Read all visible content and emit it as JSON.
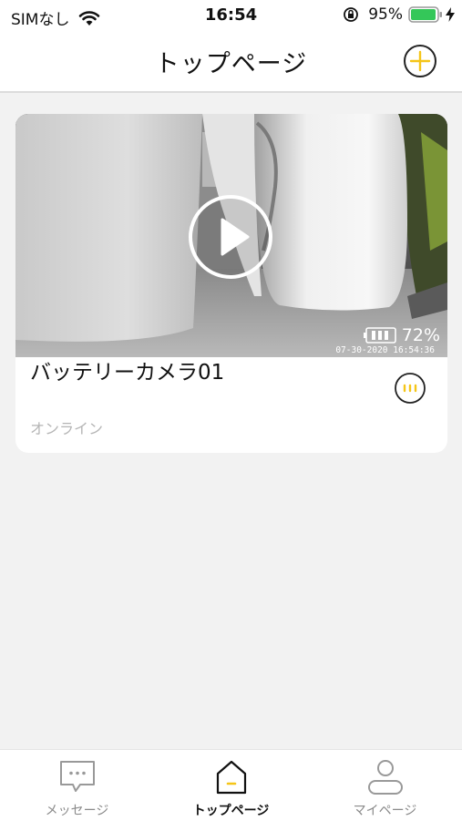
{
  "status_bar": {
    "carrier": "SIMなし",
    "time": "16:54",
    "battery": "95%"
  },
  "nav": {
    "title": "トップページ",
    "add_icon": "plus-circle-icon"
  },
  "camera_card": {
    "name": "バッテリーカメラ01",
    "status": "オンライン",
    "battery_level": "72%",
    "timestamp": "07-30-2020 16:54:36",
    "play_icon": "play-icon",
    "more_icon": "more-options-icon"
  },
  "tabs": [
    {
      "label": "メッセージ",
      "icon": "message-icon",
      "active": false
    },
    {
      "label": "トップページ",
      "icon": "home-icon",
      "active": true
    },
    {
      "label": "マイページ",
      "icon": "person-icon",
      "active": false
    }
  ],
  "colors": {
    "accent": "#f5c518",
    "battery_green": "#34c759",
    "background": "#f2f2f2"
  }
}
